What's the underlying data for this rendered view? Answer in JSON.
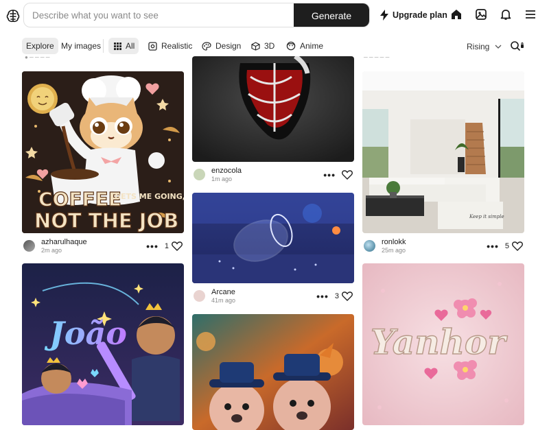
{
  "header": {
    "search_placeholder": "Describe what you want to see",
    "generate_label": "Generate",
    "upgrade_label": "Upgrade plan"
  },
  "filters": {
    "explore": "Explore",
    "my_images": "My images",
    "all": "All",
    "realistic": "Realistic",
    "design": "Design",
    "three_d": "3D",
    "anime": "Anime",
    "sort": "Rising"
  },
  "cards": {
    "coffee": {
      "username": "azharulhaque",
      "time": "2m ago",
      "likes": "1",
      "text_line1": "COFFEE",
      "text_line1b": "GETS ME GOING,",
      "text_line2": "NOT THE JOB"
    },
    "heart": {
      "username": "enzocola",
      "time": "1m ago"
    },
    "glass": {
      "username": "Arcane",
      "time": "41m ago",
      "likes": "3"
    },
    "interior": {
      "username": "ronlokk",
      "time": "25m ago",
      "likes": "5",
      "caption": "Keep it simple"
    },
    "joao": {
      "text": "João"
    },
    "yanhor": {
      "text": "Yanhor"
    }
  },
  "colors": {
    "accent_dark": "#1e1e1e",
    "chip_bg": "#ececec"
  }
}
